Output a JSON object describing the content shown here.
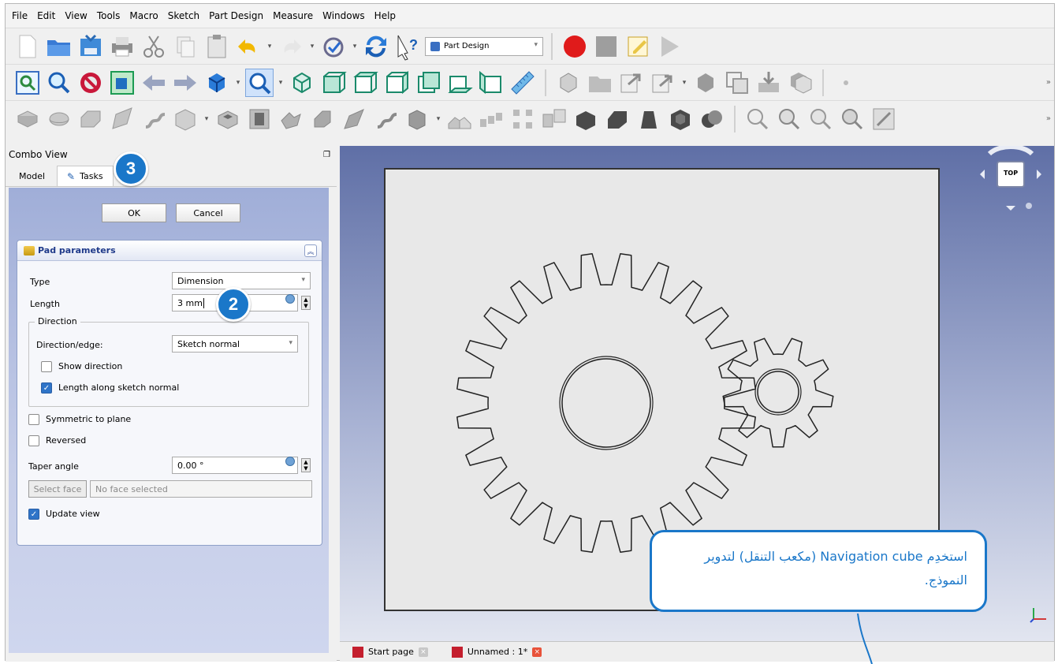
{
  "menu": [
    "File",
    "Edit",
    "View",
    "Tools",
    "Macro",
    "Sketch",
    "Part Design",
    "Measure",
    "Windows",
    "Help"
  ],
  "workbench": {
    "selected": "Part Design"
  },
  "combo_view": {
    "title": "Combo View",
    "tabs": [
      "Model",
      "Tasks"
    ],
    "ok_label": "OK",
    "cancel_label": "Cancel",
    "pad": {
      "header": "Pad parameters",
      "type_label": "Type",
      "type_value": "Dimension",
      "length_label": "Length",
      "length_value": "3 mm",
      "direction_group": "Direction",
      "direction_edge_label": "Direction/edge:",
      "direction_edge_value": "Sketch normal",
      "show_direction": {
        "label": "Show direction",
        "checked": false
      },
      "length_along_normal": {
        "label": "Length along sketch normal",
        "checked": true
      },
      "symmetric": {
        "label": "Symmetric to plane",
        "checked": false
      },
      "reversed": {
        "label": "Reversed",
        "checked": false
      },
      "taper_label": "Taper angle",
      "taper_value": "0.00 °",
      "select_face_label": "Select face",
      "face_placeholder": "No face selected",
      "update_view": {
        "label": "Update view",
        "checked": true
      }
    }
  },
  "nav_cube": {
    "face_label": "TOP"
  },
  "doc_tabs": [
    {
      "label": "Start page"
    },
    {
      "label": "Unnamed : 1*"
    }
  ],
  "callouts": {
    "step3": "3",
    "step2": "2",
    "note": "استخدِم Navigation cube (مكعب التنقل) لتدوير النموذج."
  },
  "colors": {
    "accent": "#1a77c9",
    "record": "#e01b1b",
    "task_bg": "#a0aed8",
    "sheet": "#e8e8e8"
  }
}
